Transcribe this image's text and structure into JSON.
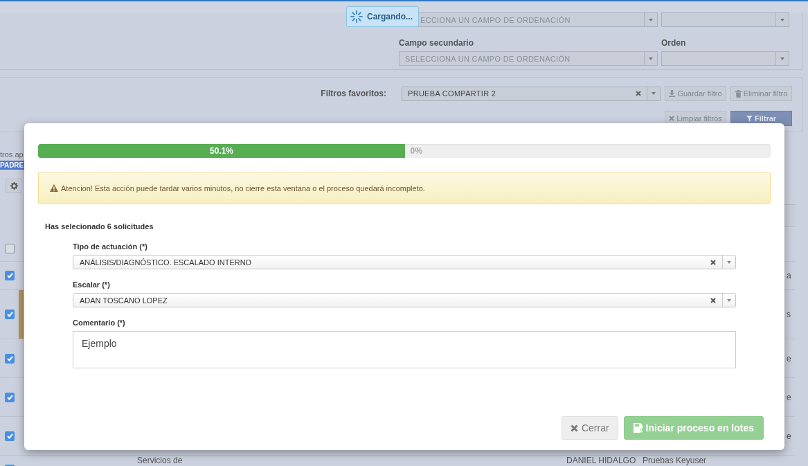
{
  "loading": {
    "label": "Cargando..."
  },
  "sort_panel": {
    "primary_value": "ECCIONA UN CAMPO DE ORDENACIÓN",
    "secondary_label": "Campo secundario",
    "order_label": "Orden",
    "secondary_value": "SELECCIONA UN CAMPO DE ORDENACIÓN"
  },
  "filter_panel": {
    "label": "Filtros favoritos:",
    "value": "PRUEBA COMPARTIR 2",
    "buttons": [
      {
        "label": "Guardar filtro",
        "kind": "download"
      },
      {
        "label": "Eliminar filtro",
        "kind": "trash"
      },
      {
        "label": "Limpiar filtros",
        "kind": "clear"
      },
      {
        "label": "Filtrar",
        "kind": "filter"
      }
    ]
  },
  "left": {
    "applied_text": "tros ap",
    "tag": "PADRE"
  },
  "table": {
    "header_checked": false,
    "rows": [
      {
        "checked": true,
        "highlighted": false,
        "end_text": "a"
      },
      {
        "checked": true,
        "highlighted": true,
        "end_text": "s"
      },
      {
        "checked": true,
        "highlighted": false,
        "end_text": "e"
      },
      {
        "checked": true,
        "highlighted": false,
        "end_text": "e"
      },
      {
        "checked": true,
        "highlighted": false,
        "end_text": "e"
      },
      {
        "checked": true,
        "highlighted": false,
        "cells": [
          "Servicios de",
          "DANIEL HIDALGO",
          "Pruebas Keyuser"
        ]
      }
    ]
  },
  "modal": {
    "progress": {
      "level": 0.501,
      "label": "50.1%",
      "remaining_label": "0%"
    },
    "warning": "Atencion! Esta acción puede tardar varios minutos, no cierre esta ventana o el proceso quedará incompleto.",
    "selection_note": "Has selecionado 6 solicitudes",
    "fields": [
      {
        "kind": "select",
        "label": "Tipo de actuación (*)",
        "value": "ANÁLISIS/DIAGNÓSTICO. ESCALADO INTERNO"
      },
      {
        "kind": "select",
        "label": "Escalar (*)",
        "value": "ADAN TOSCANO LOPEZ"
      },
      {
        "kind": "textarea",
        "label": "Comentario (*)",
        "value": "Ejemplo"
      }
    ],
    "buttons": [
      {
        "label": "Cerrar",
        "kind": "close",
        "disabled": true
      },
      {
        "label": "Iniciar proceso en lotes",
        "kind": "start",
        "disabled": true
      }
    ]
  }
}
